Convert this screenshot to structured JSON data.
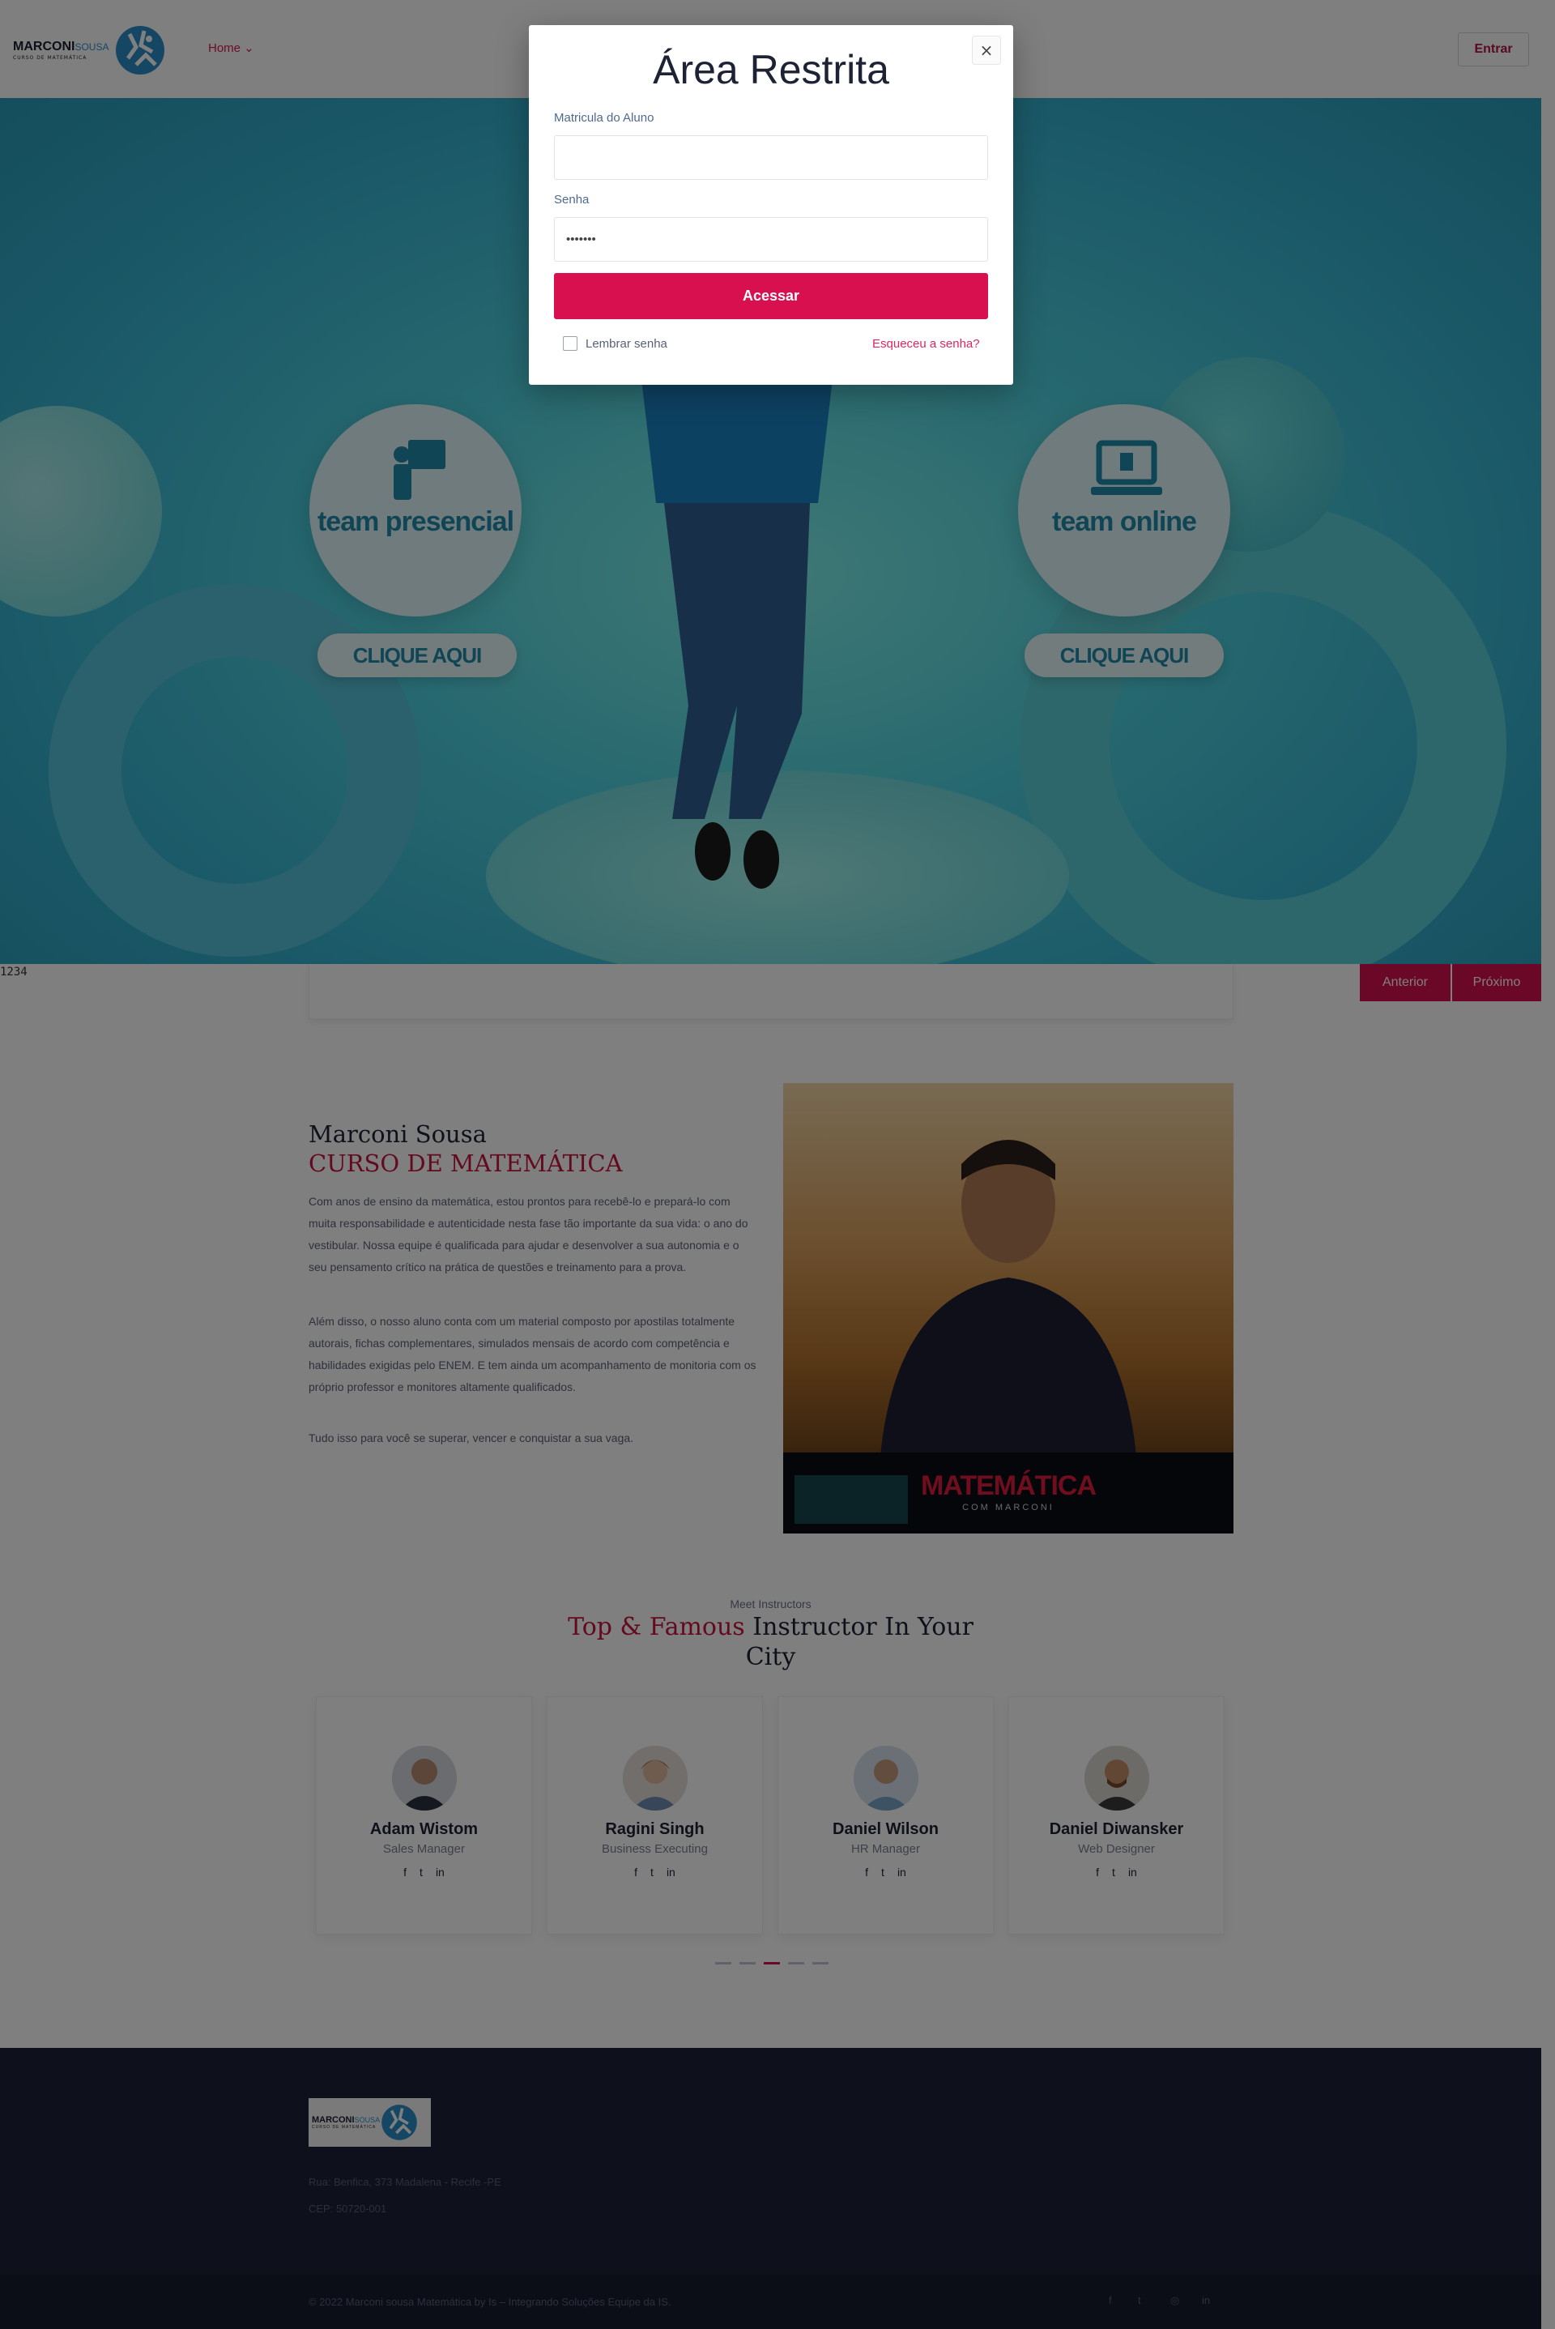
{
  "header": {
    "logo_main": "MARCONI",
    "logo_accent": "SOUSA",
    "logo_sub": "CURSO DE MATEMÁTICA",
    "nav_home": "Home ⌄",
    "login_button": "Entrar"
  },
  "hero": {
    "left_card": {
      "label": "team presencial",
      "cta": "CLIQUE AQUI"
    },
    "right_card": {
      "label": "team online",
      "cta": "CLIQUE AQUI"
    },
    "slide_counter": "1234",
    "prev_label": "Anterior",
    "next_label": "Próximo"
  },
  "about": {
    "title": "Marconi Sousa",
    "subtitle": "CURSO DE MATEMÁTICA",
    "paragraph_1": "Com anos de ensino da matemática, estou prontos para recebê-lo e prepará-lo com muita responsabilidade e autenticidade nesta fase tão importante da sua vida: o ano do vestibular. Nossa equipe é qualificada para ajudar e desenvolver a sua autonomia e o seu pensamento crítico na prática de questões e treinamento para a prova.",
    "paragraph_2": "Além disso, o nosso aluno conta com um material composto por apostilas totalmente autorais, fichas complementares, simulados mensais de acordo com competência e habilidades exigidas pelo ENEM. E tem ainda um acompanhamento de monitoria com os próprio professor e monitores altamente qualificados.",
    "paragraph_3": "Tudo isso para você se superar, vencer e conquistar a sua vaga.",
    "photo_banner_title": "MATEMÁTICA",
    "photo_banner_sub": "COM MARCONI"
  },
  "instructors": {
    "eyebrow": "Meet Instructors",
    "heading_accent": "Top & Famous",
    "heading_rest": " Instructor In Your City",
    "items": [
      {
        "name": "Adam Wistom",
        "role": "Sales Manager"
      },
      {
        "name": "Ragini Singh",
        "role": "Business Executing"
      },
      {
        "name": "Daniel Wilson",
        "role": "HR Manager"
      },
      {
        "name": "Daniel Diwansker",
        "role": "Web Designer"
      }
    ],
    "social_icons": [
      "f",
      "t",
      "in"
    ]
  },
  "footer": {
    "address": "Rua: Benfica, 373 Madalena - Recife -PE",
    "cep": "CEP: 50720-001",
    "copyright": "© 2022 Marconi sousa Matemática by Is – Integrando Soluções Equipe da IS.",
    "social": [
      "f",
      "t",
      "◎",
      "in"
    ]
  },
  "modal": {
    "title": "Área Restrita",
    "close_icon": "×",
    "matricula_label": "Matricula do Aluno",
    "matricula_value": "",
    "senha_label": "Senha",
    "senha_value": "•••••••",
    "submit_label": "Acessar",
    "remember_label": "Lembrar senha",
    "forgot_label": "Esqueceu a senha?"
  },
  "colors": {
    "accent": "#d8104f",
    "brand_blue": "#2b8fc9",
    "dark_navy": "#1d2235"
  }
}
